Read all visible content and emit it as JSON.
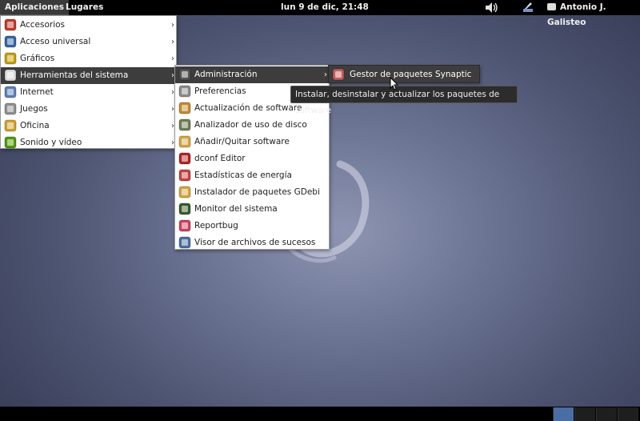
{
  "top_panel": {
    "applications": "Aplicaciones",
    "places": "Lugares",
    "clock": "lun  9 de dic, 21:48",
    "user": "Antonio J. Galisteo",
    "volume_icon": "speaker-icon",
    "tray_icon": "update-notifier-icon"
  },
  "apps_menu": {
    "items": [
      {
        "label": "Accesorios",
        "icon": "accessories-icon",
        "color": "#c0392b"
      },
      {
        "label": "Acceso universal",
        "icon": "accessibility-icon",
        "color": "#3465a4"
      },
      {
        "label": "Gráficos",
        "icon": "graphics-icon",
        "color": "#c4a000"
      },
      {
        "label": "Herramientas del sistema",
        "icon": "system-tools-icon",
        "color": "#dddddd"
      },
      {
        "label": "Internet",
        "icon": "internet-icon",
        "color": "#5c7fb8"
      },
      {
        "label": "Juegos",
        "icon": "games-icon",
        "color": "#8f8f8f"
      },
      {
        "label": "Oficina",
        "icon": "office-icon",
        "color": "#d2a030"
      },
      {
        "label": "Sonido y vídeo",
        "icon": "multimedia-icon",
        "color": "#4e9a06"
      }
    ]
  },
  "system_menu": {
    "items": [
      {
        "label": "Administración",
        "icon": "administration-icon"
      },
      {
        "label": "Preferencias",
        "icon": "preferences-icon"
      },
      {
        "label": "Actualización de software",
        "icon": "software-update-icon"
      },
      {
        "label": "Analizador de uso de disco",
        "icon": "disk-usage-icon"
      },
      {
        "label": "Añadir/Quitar software",
        "icon": "add-remove-software-icon"
      },
      {
        "label": "dconf Editor",
        "icon": "dconf-editor-icon"
      },
      {
        "label": "Estadísticas de energía",
        "icon": "power-statistics-icon"
      },
      {
        "label": "Instalador de paquetes GDebi",
        "icon": "gdebi-icon"
      },
      {
        "label": "Monitor del sistema",
        "icon": "system-monitor-icon"
      },
      {
        "label": "Reportbug",
        "icon": "reportbug-icon"
      },
      {
        "label": "Visor de archivos de sucesos",
        "icon": "log-viewer-icon"
      }
    ]
  },
  "admin_menu": {
    "items": [
      {
        "label": "Gestor de paquetes Synaptic",
        "icon": "synaptic-icon"
      }
    ]
  },
  "tooltip": "Instalar, desinstalar y actualizar los paquetes de software",
  "arrow_glyph": "›",
  "selected_color": "#3d3d3d",
  "active_workspace_color": "#4a6ea3"
}
